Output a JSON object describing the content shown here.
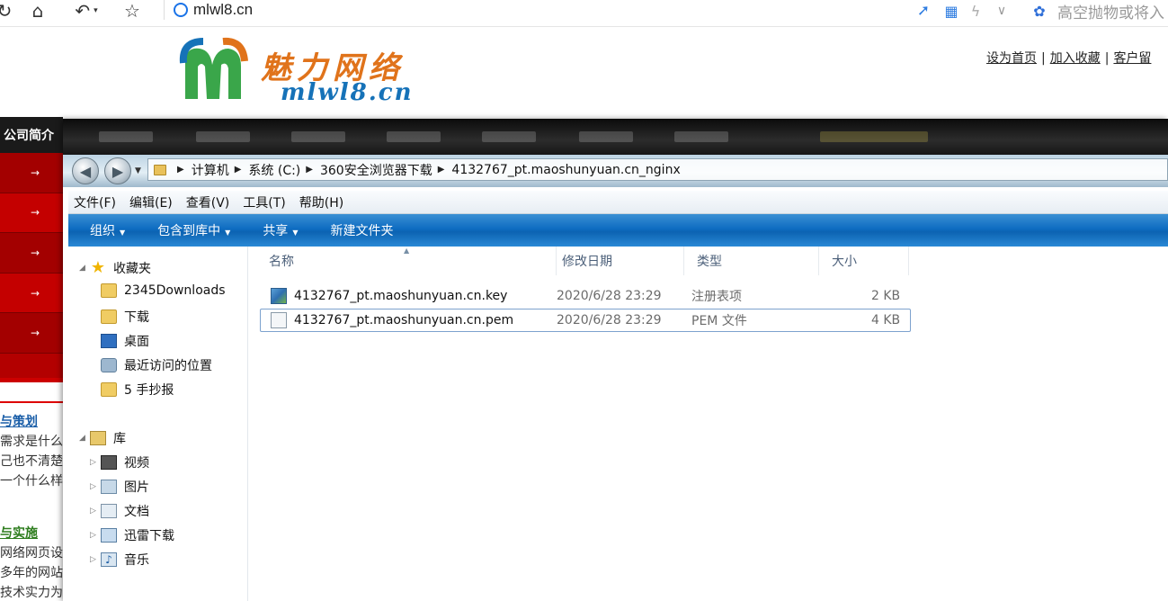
{
  "browser": {
    "url": "mlwl8.cn",
    "search_hint": "高空抛物或将入",
    "search_engine_icon": "paw-icon"
  },
  "site": {
    "logo_cn": "魅力网络",
    "logo_domain": "mlwl8.cn",
    "top_links": [
      "设为首页",
      "加入收藏",
      "客户留"
    ],
    "nav_first": "公司简介",
    "sidebar_arrows": [
      "→",
      "→",
      "→",
      "→",
      "→"
    ],
    "heading1": "与策划",
    "text1": [
      "需求是什么",
      "己也不清楚",
      "一个什么样"
    ],
    "heading2": "与实施",
    "text2": [
      "网络网页设",
      "多年的网站",
      "技术实力为"
    ],
    "colors": {
      "sidebar": "#b30000",
      "logo_orange": "#e0731b",
      "logo_blue": "#1672b8"
    }
  },
  "explorer": {
    "breadcrumb": [
      "计算机",
      "系统 (C:)",
      "360安全浏览器下载",
      "4132767_pt.maoshunyuan.cn_nginx"
    ],
    "menu": [
      "文件(F)",
      "编辑(E)",
      "查看(V)",
      "工具(T)",
      "帮助(H)"
    ],
    "toolbar": [
      {
        "label": "组织",
        "dropdown": true
      },
      {
        "label": "包含到库中",
        "dropdown": true
      },
      {
        "label": "共享",
        "dropdown": true
      },
      {
        "label": "新建文件夹",
        "dropdown": false
      }
    ],
    "nav_pane": {
      "favorites": {
        "label": "收藏夹",
        "items": [
          "2345Downloads",
          "下载",
          "桌面",
          "最近访问的位置",
          "5 手抄报"
        ]
      },
      "libraries": {
        "label": "库",
        "items": [
          "视频",
          "图片",
          "文档",
          "迅雷下载",
          "音乐"
        ]
      }
    },
    "columns": [
      "名称",
      "修改日期",
      "类型",
      "大小"
    ],
    "files": [
      {
        "name": "4132767_pt.maoshunyuan.cn.key",
        "modified": "2020/6/28 23:29",
        "type": "注册表项",
        "size": "2 KB",
        "icon": "registry-file-icon"
      },
      {
        "name": "4132767_pt.maoshunyuan.cn.pem",
        "modified": "2020/6/28 23:29",
        "type": "PEM 文件",
        "size": "4 KB",
        "icon": "blank-file-icon"
      }
    ],
    "colors": {
      "toolbar": "#0e6cc1",
      "selection_border": "#7da2ce"
    }
  }
}
